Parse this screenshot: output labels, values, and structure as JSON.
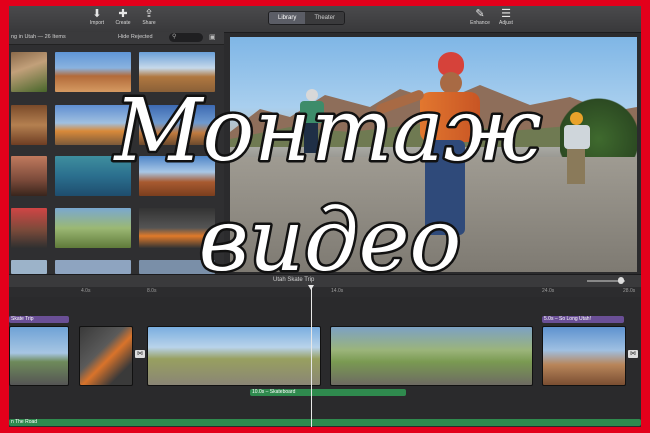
{
  "toolbar": {
    "import_label": "Import",
    "create_label": "Create",
    "share_label": "Share",
    "library_tab": "Library",
    "theater_tab": "Theater",
    "enhance_label": "Enhance",
    "adjust_label": "Adjust"
  },
  "browser": {
    "header_title": "ng in Utah — 26 Items",
    "filter_label": "Hide Rejected",
    "search_icon": "search-icon"
  },
  "timeline": {
    "project_title": "Utah Skate Trip",
    "ruler_ticks": [
      "4.0s",
      "8.0s",
      "14.0s",
      "24.0s",
      "28.0s"
    ],
    "title_tag_left": "Skate Trip",
    "title_tag_right": "5.0s – So Long Utah!",
    "green_clip_label": "10.0s – Skateboard",
    "music_label": "n The Road"
  },
  "overlay": {
    "line1": "Монтаж",
    "line2": "видео"
  },
  "colors": {
    "frame_border": "#e3001b",
    "title_tag": "#6a4f96",
    "green_track": "#2f8a4e"
  }
}
